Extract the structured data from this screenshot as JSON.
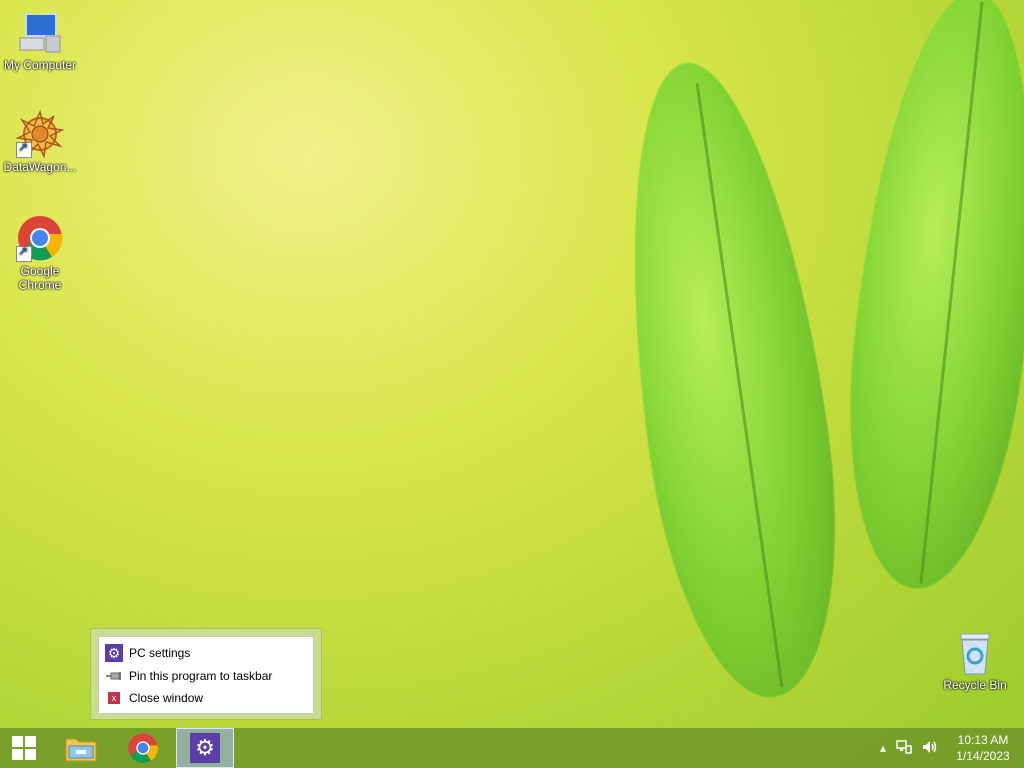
{
  "desktop": {
    "icons": [
      {
        "label": "My Computer"
      },
      {
        "label": "DataWagon..."
      },
      {
        "label": "Google Chrome"
      },
      {
        "label": "Recycle Bin"
      }
    ]
  },
  "jumplist": {
    "items": [
      {
        "label": "PC settings"
      },
      {
        "label": "Pin this program to taskbar"
      },
      {
        "label": "Close window"
      }
    ]
  },
  "taskbar": {
    "clock_time": "10:13 AM",
    "clock_date": "1/14/2023",
    "buttons": [
      "start-icon",
      "file-explorer-icon",
      "chrome-icon",
      "settings-icon"
    ]
  },
  "colors": {
    "accent": "#5b3ea8",
    "taskbar": "#6e9628"
  }
}
